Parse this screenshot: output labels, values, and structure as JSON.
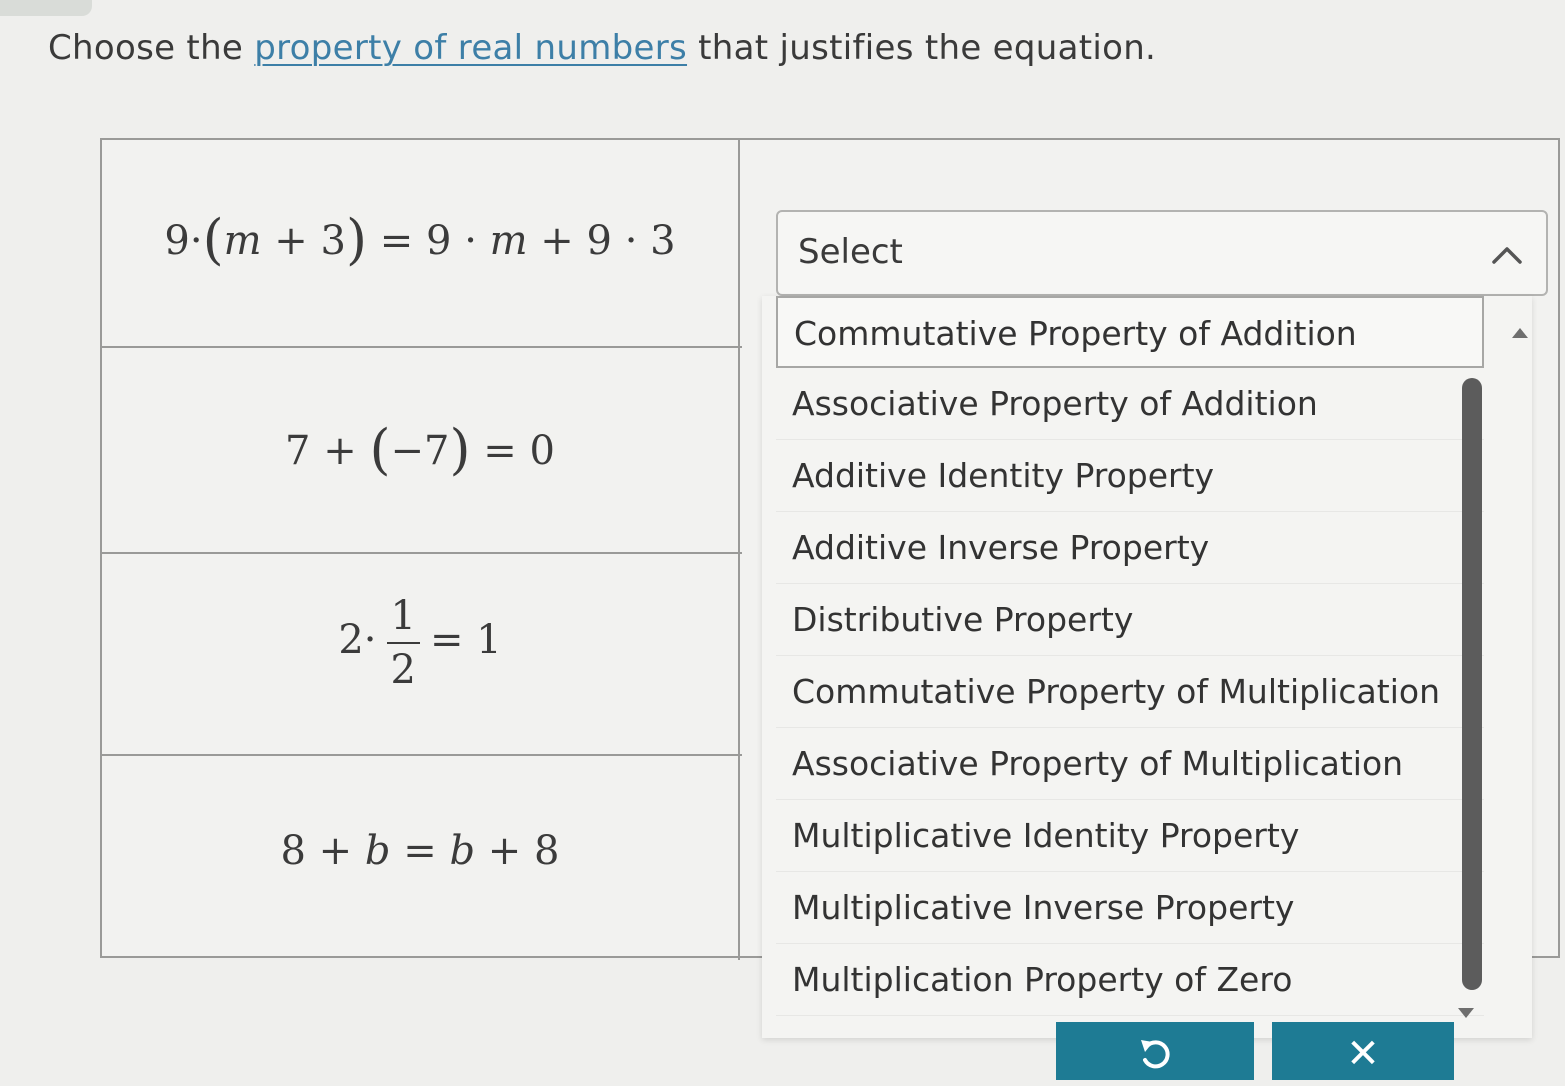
{
  "prompt": {
    "before": "Choose the ",
    "link": "property of real numbers",
    "after": " that justifies the equation."
  },
  "equations": [
    {
      "lhs_num": "9",
      "lhs_var": "m",
      "lhs_const": "3",
      "rhs_a": "9",
      "rhs_var": "m",
      "rhs_b": "9",
      "rhs_c": "3"
    },
    {
      "a": "7",
      "b": "−7",
      "result": "0"
    },
    {
      "a": "2",
      "num": "1",
      "den": "2",
      "result": "1"
    },
    {
      "a": "8",
      "var1": "b",
      "var2": "b",
      "b": "8"
    }
  ],
  "select": {
    "label": "Select"
  },
  "options": [
    "Commutative Property of Addition",
    "Associative Property of Addition",
    "Additive Identity Property",
    "Additive Inverse Property",
    "Distributive Property",
    "Commutative Property of Multiplication",
    "Associative Property of Multiplication",
    "Multiplicative Identity Property",
    "Multiplicative Inverse Property",
    "Multiplication Property of Zero"
  ],
  "buttons": {
    "undo_icon": "undo-icon",
    "close_icon": "close-icon",
    "close_glyph": "✕"
  },
  "colors": {
    "link": "#3d7fa7",
    "button": "#1e7b94"
  }
}
